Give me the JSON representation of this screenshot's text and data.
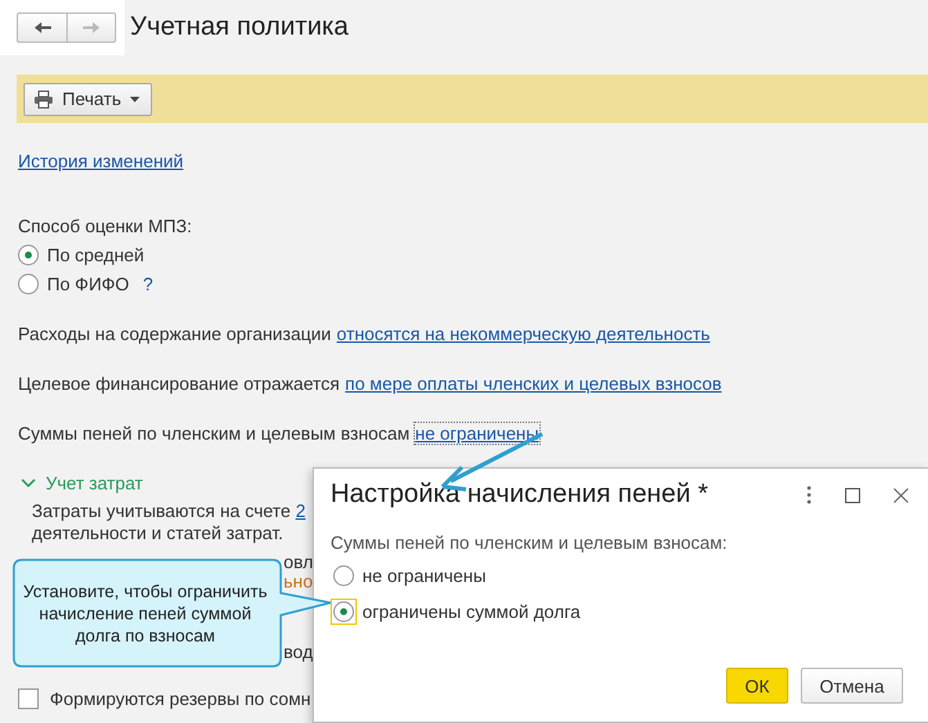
{
  "nav_buttons": [
    {
      "kind": "back",
      "disabled": false
    },
    {
      "kind": "forward",
      "disabled": true
    }
  ],
  "title": "Учетная политика",
  "toolbar": {
    "print_button": "Печать"
  },
  "history_link": "История изменений",
  "valuation": {
    "label": "Способ оценки МПЗ:",
    "options": [
      {
        "label": "По средней",
        "selected": true
      },
      {
        "label": "По ФИФО",
        "selected": false
      }
    ],
    "help": "?"
  },
  "settings": [
    {
      "text": "Расходы на содержание организации",
      "link": "относятся на некоммерческую деятельность",
      "focused": false
    },
    {
      "text": "Целевое финансирование отражается",
      "link": "по мере оплаты членских и целевых взносов",
      "focused": false
    },
    {
      "text": "Суммы пеней по членским и целевым взносам",
      "link": "не ограничены",
      "focused": true
    }
  ],
  "cost_section": {
    "title": "Учет затрат",
    "expanded": true,
    "line_1": "Затраты учитываются на счете",
    "line_1_link": "2",
    "line_2": "деятельности и статей затрат.",
    "fragment_1": "овл",
    "fragment_2": "ьно",
    "fragment_3": "вод"
  },
  "reserve_checkbox": {
    "label": "Формируются резервы по сомн",
    "checked": false
  },
  "dialog": {
    "title": "Настройка начисления пеней *",
    "label": "Суммы пеней по членским и целевым взносам:",
    "options": [
      {
        "label": "не ограничены",
        "selected": false,
        "focused": false
      },
      {
        "label": "ограничены суммой долга",
        "selected": true,
        "focused": true
      }
    ],
    "ok": "ОК",
    "cancel": "Отмена"
  },
  "callout": "Установите, чтобы ограничить начисление пеней суммой долга по взносам"
}
